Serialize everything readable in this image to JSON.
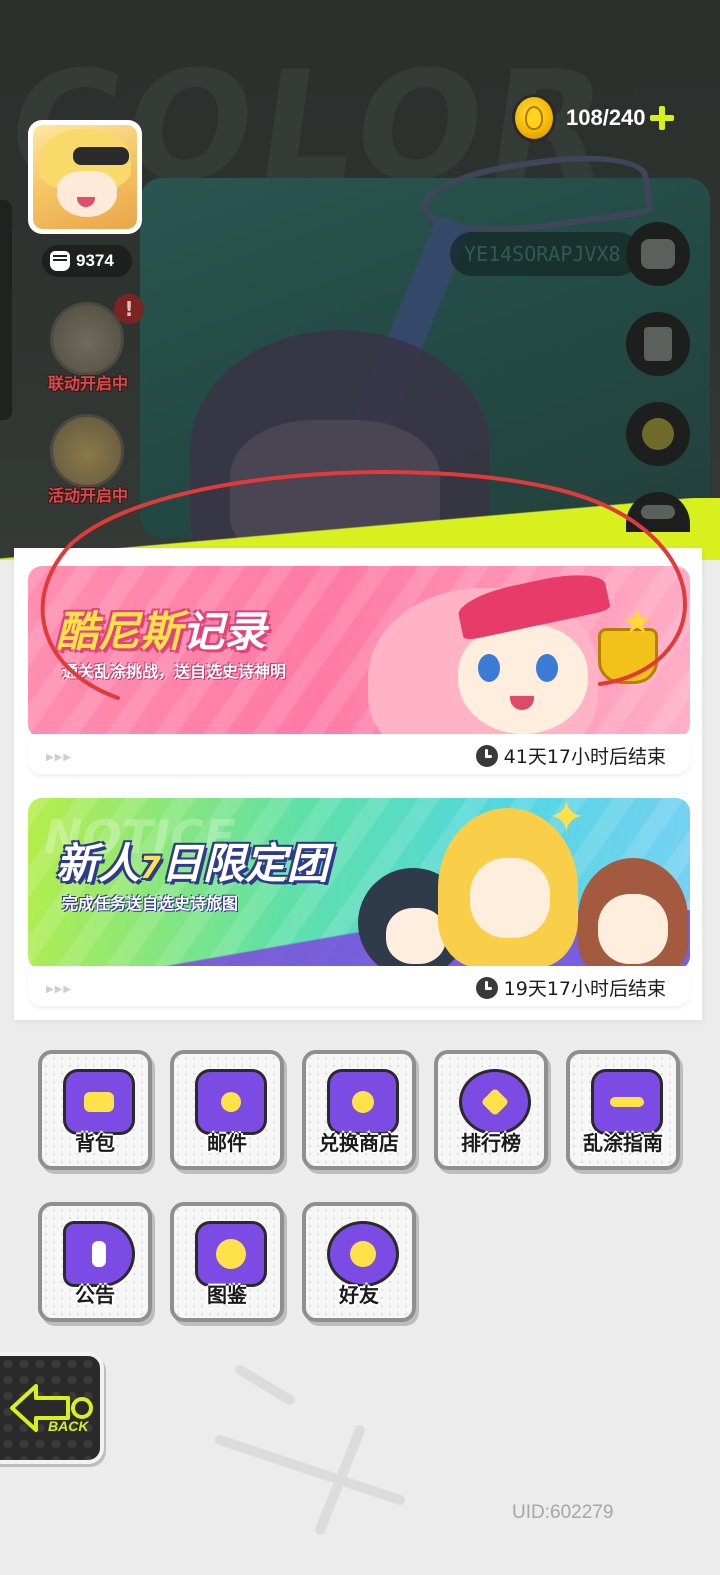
{
  "header": {
    "bg_text": "COLOR",
    "energy": "108/240",
    "code_text": "YE14SORAPJVX8"
  },
  "profile": {
    "power": "9374"
  },
  "left_events": [
    {
      "label": "联动开启中",
      "alert": "!"
    },
    {
      "label": "活动开启中"
    }
  ],
  "right_buttons": [
    "chat-icon",
    "document-check-icon",
    "star-icon",
    "more-icon"
  ],
  "events": [
    {
      "title_main": "酷尼斯",
      "title_tail": "记录",
      "subtitle": "通关乱涂挑战，送自选史诗神明",
      "timer": "41天17小时后结束"
    },
    {
      "watermark": "NOTICE",
      "title_main": "新人",
      "title_num": "7",
      "title_tail": "日限定团",
      "subtitle": "完成任务送自选史诗旅图",
      "timer": "19天17小时后结束"
    }
  ],
  "menu": [
    {
      "label": "背包",
      "icon": "backpack-icon"
    },
    {
      "label": "邮件",
      "icon": "mail-icon"
    },
    {
      "label": "兑换商店",
      "icon": "shop-icon"
    },
    {
      "label": "排行榜",
      "icon": "trophy-icon"
    },
    {
      "label": "乱涂指南",
      "icon": "guide-icon"
    },
    {
      "label": "公告",
      "icon": "megaphone-icon"
    },
    {
      "label": "图鉴",
      "icon": "album-icon"
    },
    {
      "label": "好友",
      "icon": "friends-icon"
    }
  ],
  "back": {
    "label": "BACK"
  },
  "footer": {
    "uid": "UID:602279"
  },
  "colors": {
    "accent_yellow": "#d7f01e",
    "purple": "#7b4be3",
    "pink": "#ff7aa6",
    "annotation_red": "#e03a3a"
  }
}
